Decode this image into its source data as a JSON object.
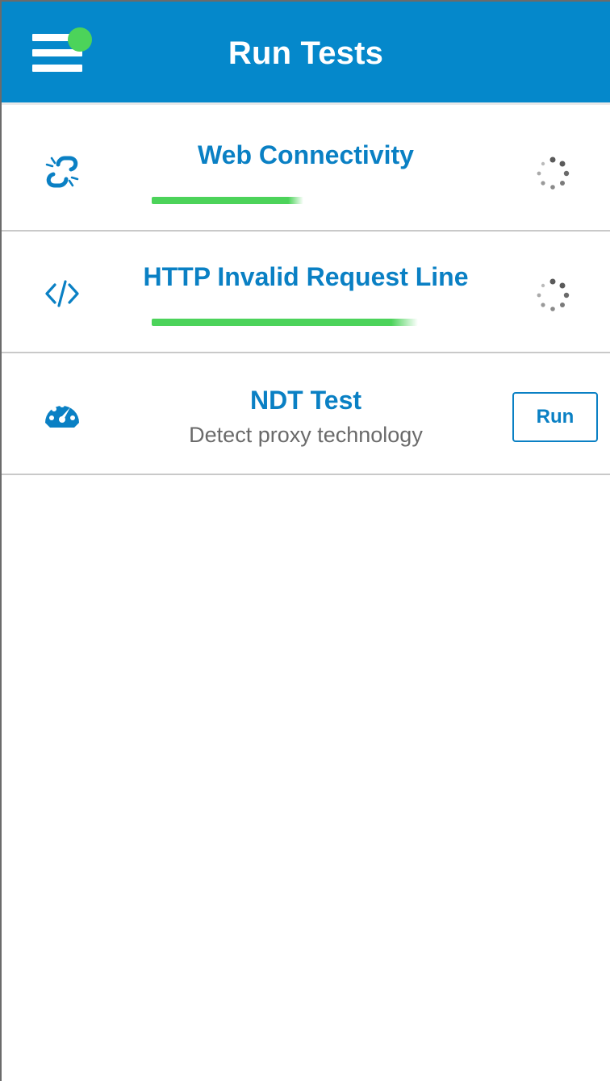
{
  "header": {
    "title": "Run Tests",
    "menu_icon": "hamburger-menu-icon",
    "notification_color": "#4cd35a",
    "background_color": "#0588cb"
  },
  "tests": [
    {
      "title": "Web Connectivity",
      "icon": "broken-link-icon",
      "status": "running",
      "progress": 0.57
    },
    {
      "title": "HTTP Invalid Request Line",
      "icon": "code-brackets-icon",
      "status": "running",
      "progress": 1.0
    },
    {
      "title": "NDT Test",
      "subtitle": "Detect proxy technology",
      "icon": "speedometer-icon",
      "status": "idle",
      "run_label": "Run"
    }
  ],
  "colors": {
    "accent": "#0a80c4",
    "progress": "#4cd35a",
    "divider": "#c9c9c9"
  }
}
